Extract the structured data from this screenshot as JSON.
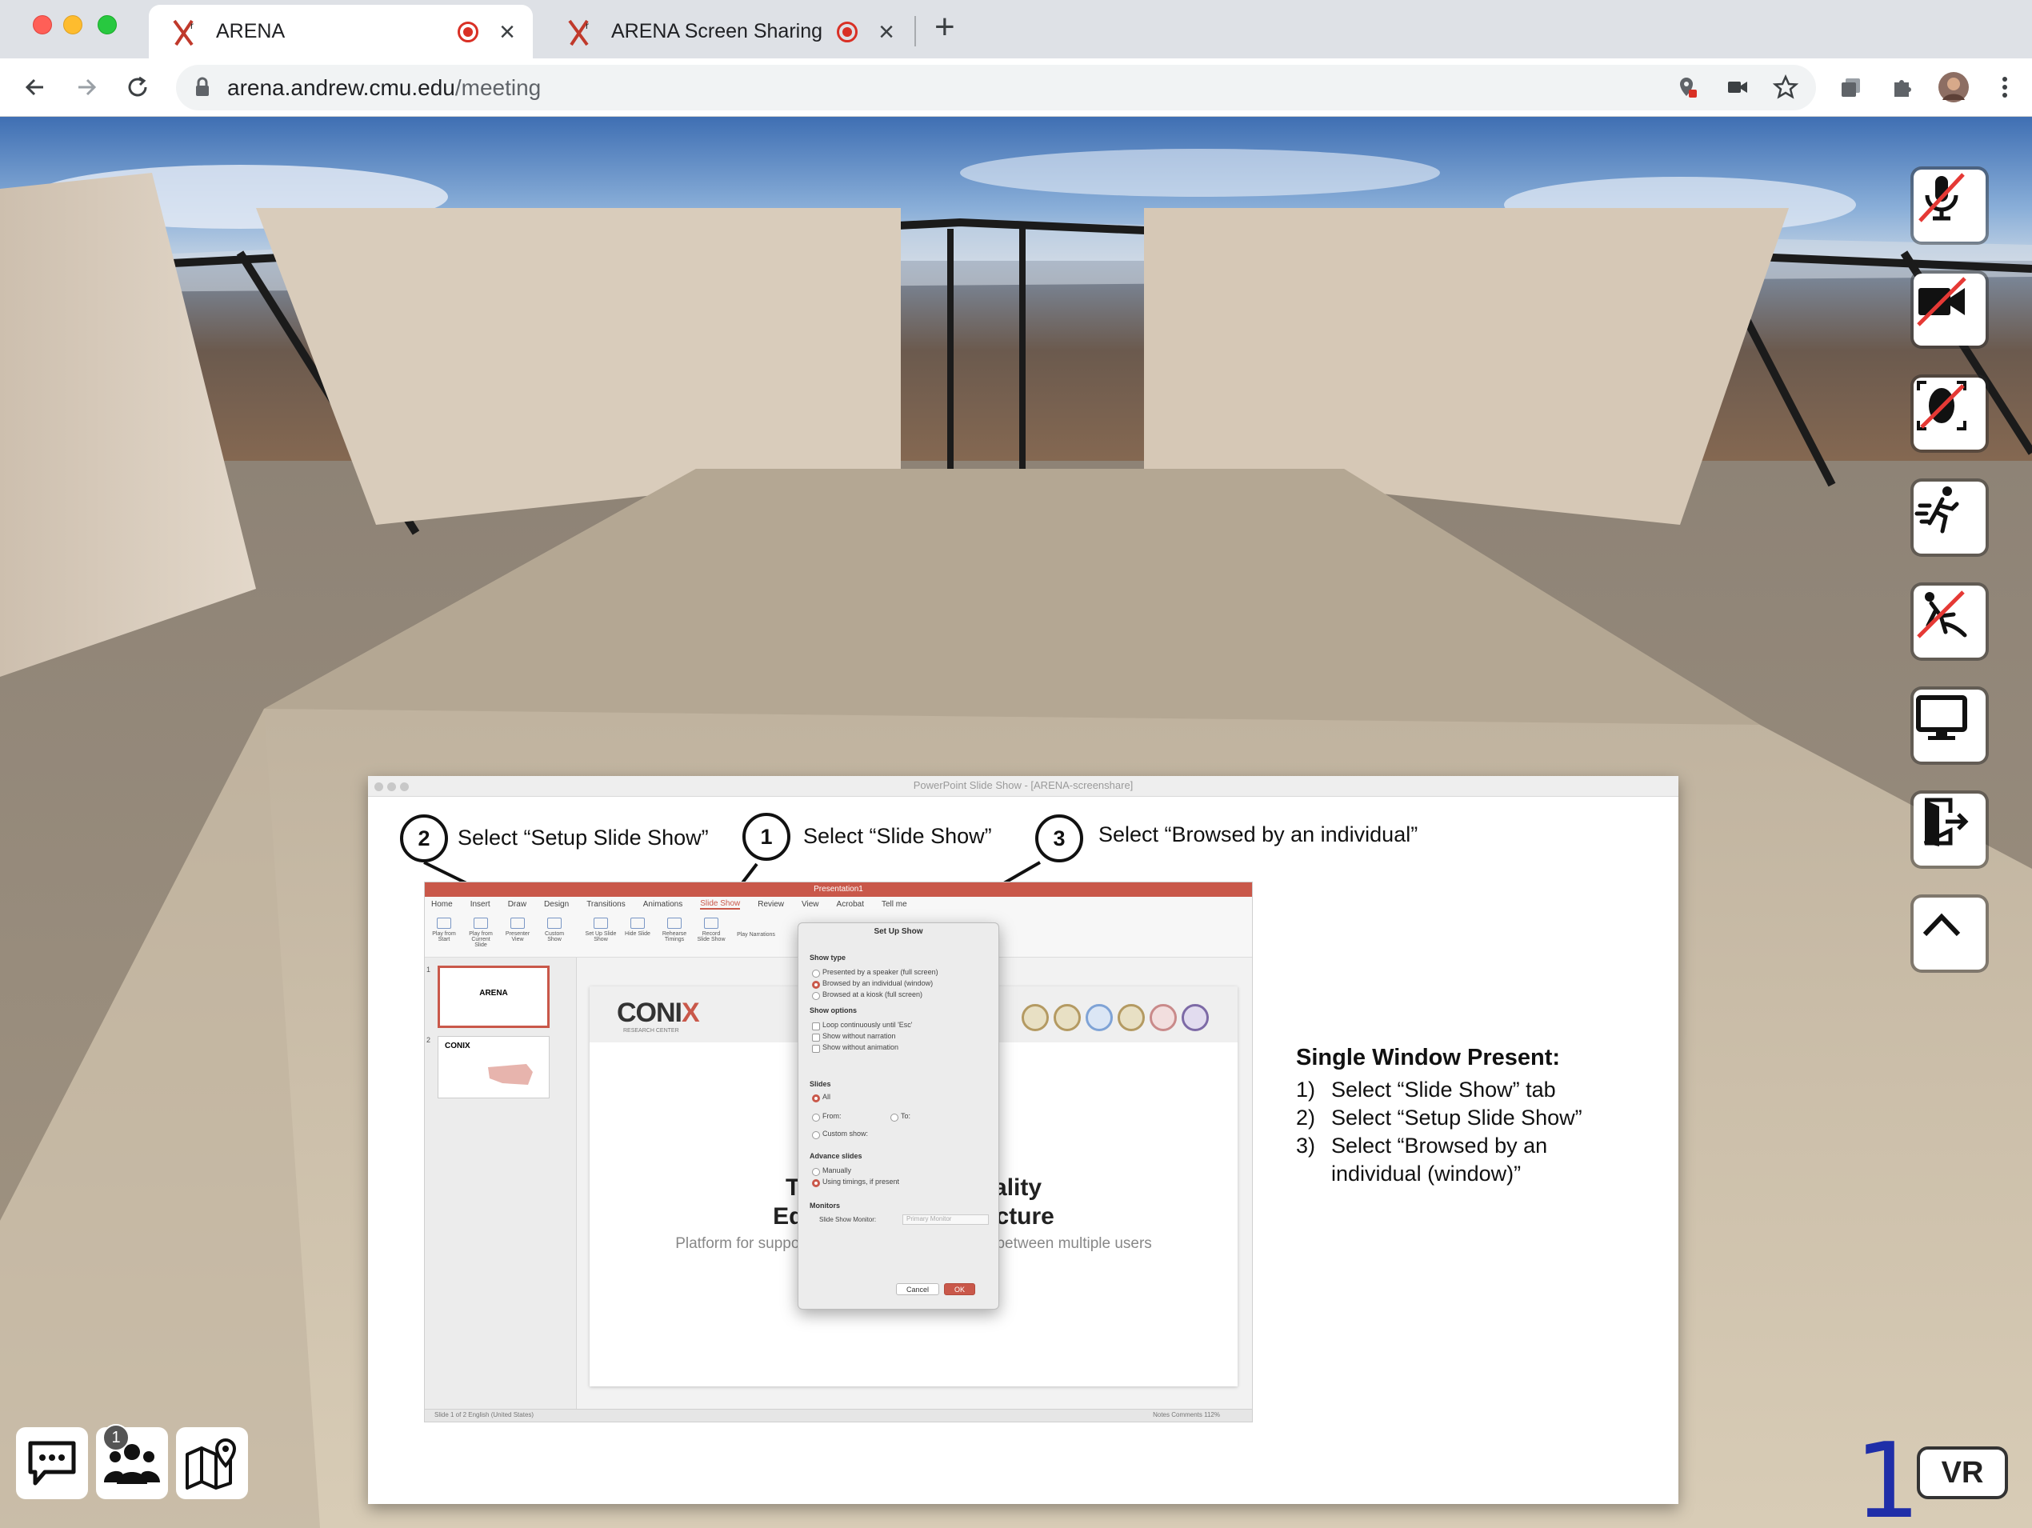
{
  "browser": {
    "tabs": [
      {
        "title": "ARENA",
        "active": true
      },
      {
        "title": "ARENA Screen Sharing",
        "active": false
      }
    ],
    "tab_close_glyph": "×",
    "new_tab_glyph": "+",
    "url_host": "arena.andrew.cmu.edu",
    "url_path": "/meeting",
    "accent": "#d93025"
  },
  "screenshare": {
    "window_title": "PowerPoint Slide Show - [ARENA-screenshare]",
    "steps": [
      {
        "num": "2",
        "label": "Select “Setup Slide Show”"
      },
      {
        "num": "1",
        "label": "Select “Slide Show”"
      },
      {
        "num": "3",
        "label": "Select “Browsed by an individual”"
      }
    ],
    "ppt": {
      "top_title": "Presentation1",
      "menu": [
        "Home",
        "Insert",
        "Draw",
        "Design",
        "Transitions",
        "Animations",
        "Slide Show",
        "Review",
        "View",
        "Acrobat",
        "Tell me"
      ],
      "ribbon": [
        "Play from Start",
        "Play from Current Slide",
        "Presenter View",
        "Custom Show",
        "Set Up Slide Show",
        "Hide Slide",
        "Rehearse Timings",
        "Record Slide Show",
        "Play Narrations"
      ],
      "thumb_numbers": [
        "1",
        "2"
      ],
      "thumb_1_title": "ARENA",
      "thumb_2_logo": "CONIX",
      "slide_logo_main": "CONI",
      "slide_logo_accent": "X",
      "slide_logo_sub": "RESEARCH CENTER",
      "slide_title_line1": "T                           eality",
      "slide_title_line2": "Edge N                   ecture",
      "slide_subtitle": "Platform for supporting real-time XR interaction between multiple users and the physical world",
      "status_left": "Slide 1 of 2    English (United States)",
      "status_right": "Notes   Comments   112%"
    },
    "dialog": {
      "title": "Set Up Show",
      "show_type_label": "Show type",
      "show_type_options": [
        "Presented by a speaker (full screen)",
        "Browsed by an individual (window)",
        "Browsed at a kiosk (full screen)"
      ],
      "show_options_label": "Show options",
      "show_options": [
        "Loop continuously until 'Esc'",
        "Show without narration",
        "Show without animation"
      ],
      "slides_label": "Slides",
      "slides_options": [
        "All",
        "From:",
        "To:",
        "Custom show:"
      ],
      "advance_label": "Advance slides",
      "advance_options": [
        "Manually",
        "Using timings, if present"
      ],
      "monitors_label": "Monitors",
      "monitor_field": "Slide Show Monitor:",
      "monitor_value": "Primary Monitor",
      "cancel": "Cancel",
      "ok": "OK"
    },
    "instructions": {
      "title": "Single Window Present:",
      "items": [
        {
          "n": "1)",
          "text": "Select “Slide Show” tab"
        },
        {
          "n": "2)",
          "text": "Select “Setup Slide Show”"
        },
        {
          "n": "3)",
          "text": "Select “Browsed by an individual (window)”"
        }
      ]
    }
  },
  "arena": {
    "side_buttons": [
      "mic-muted",
      "camera-off",
      "face-tracking-off",
      "fly-mode",
      "avatar-off",
      "screen-share",
      "exit",
      "collapse"
    ],
    "bottom_buttons": [
      "chat",
      "users",
      "map"
    ],
    "user_count": "1",
    "vr_label": "VR",
    "fps_counter": "1",
    "fps_color": "#1f2ea8"
  }
}
